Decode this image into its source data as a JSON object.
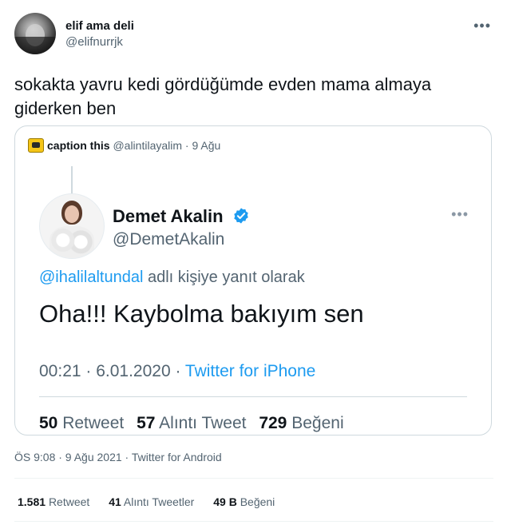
{
  "tweet": {
    "author": {
      "name": "elif ama deli",
      "handle": "@elifnurrjk"
    },
    "more_icon": "more-horizontal-icon",
    "text": "sokakta yavru kedi gördüğümde evden mama almaya giderken ben",
    "timestamp": "ÖS 9:08 · 9 Ağu 2021 · Twitter for Android",
    "stats": {
      "retweets_count": "1.581",
      "retweets_label": "Retweet",
      "quotes_count": "41",
      "quotes_label": "Alıntı Tweetler",
      "likes_count": "49 B",
      "likes_label": "Beğeni"
    }
  },
  "quoted": {
    "account": {
      "name": "caption this",
      "handle": "@alintilayalim",
      "date": "· 9 Ağu"
    },
    "inner": {
      "name": "Demet Akalin",
      "handle": "@DemetAkalin",
      "verified": true,
      "reply_mention": "@ihalilaltundal",
      "reply_suffix": " adlı kişiye yanıt olarak",
      "text": "Oha!!! Kaybolma bakıyım sen",
      "time_date": "00:21 · 6.01.2020 · ",
      "source": "Twitter for iPhone",
      "stats": {
        "retweets_count": "50",
        "retweets_label": "Retweet",
        "quotes_count": "57",
        "quotes_label": "Alıntı Tweet",
        "likes_count": "729",
        "likes_label": "Beğeni"
      }
    }
  },
  "colors": {
    "accent": "#1d9bf0",
    "muted": "#536471",
    "border": "#cfd9de"
  }
}
